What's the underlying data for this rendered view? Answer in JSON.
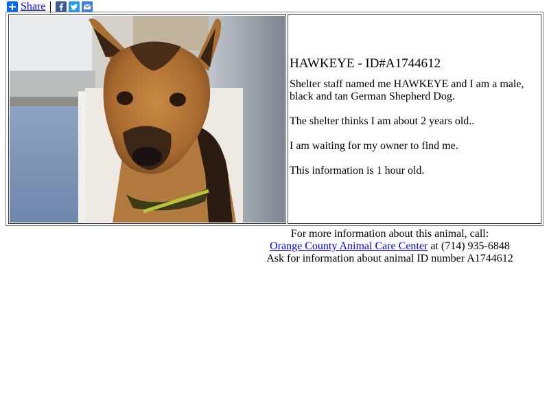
{
  "share": {
    "label": "Share",
    "icons": [
      "plus-icon",
      "facebook-icon",
      "twitter-icon",
      "email-icon"
    ],
    "colors": {
      "share": "#0166ff",
      "facebook": "#3b5998",
      "twitter": "#1d9bf0",
      "email": "#3d7ddb"
    }
  },
  "animal": {
    "title": "HAWKEYE - ID#A1744612",
    "description": "Shelter staff named me HAWKEYE and I am a male, black and tan German Shepherd Dog.",
    "age": "The shelter thinks I am about 2 years old..",
    "status": "I am waiting for my owner to find me.",
    "freshness": "This information is 1 hour old."
  },
  "contact": {
    "line1": "For more information about this animal, call:",
    "shelter_name": "Orange County Animal Care Center",
    "at_phone": " at (714) 935-6848",
    "line3": "Ask for information about animal ID number A1744612"
  },
  "colors": {
    "link": "#0000ee"
  }
}
